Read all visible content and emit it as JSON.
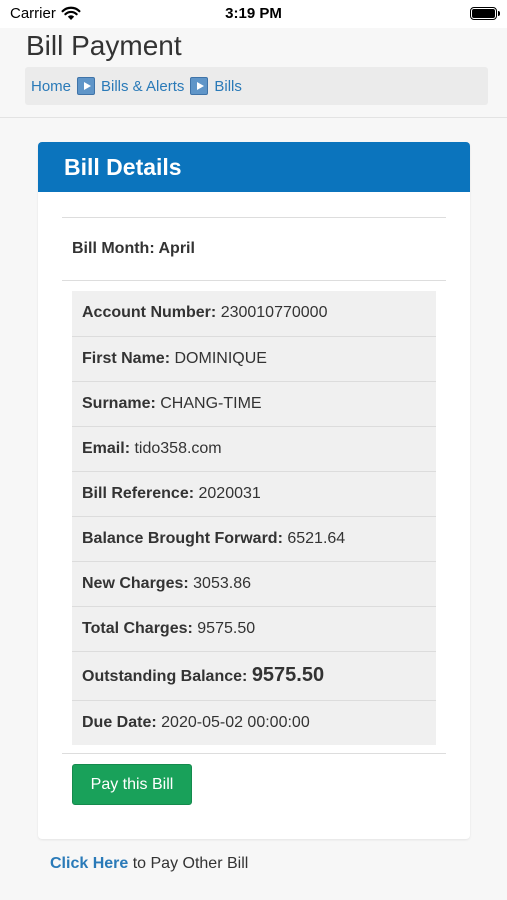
{
  "status_bar": {
    "carrier": "Carrier",
    "time": "3:19 PM"
  },
  "header": {
    "title": "Bill Payment",
    "breadcrumb": [
      "Home",
      "Bills & Alerts",
      "Bills"
    ]
  },
  "panel": {
    "heading": "Bill Details",
    "bill_month": "Bill Month: April",
    "rows": [
      {
        "label": "Account Number:",
        "value": "230010770000"
      },
      {
        "label": "First Name:",
        "value": "DOMINIQUE"
      },
      {
        "label": "Surname:",
        "value": "CHANG-TIME"
      },
      {
        "label": "Email:",
        "value": "tido358.com"
      },
      {
        "label": "Bill Reference:",
        "value": "2020031"
      },
      {
        "label": "Balance Brought Forward:",
        "value": "6521.64"
      },
      {
        "label": "New Charges:",
        "value": "3053.86"
      },
      {
        "label": "Total Charges:",
        "value": "9575.50"
      },
      {
        "label": "Outstanding Balance:",
        "value": "9575.50"
      },
      {
        "label": "Due Date:",
        "value": "2020-05-02 00:00:00"
      }
    ],
    "pay_button": "Pay this Bill"
  },
  "footer": {
    "link": "Click Here",
    "text": " to Pay Other Bill"
  }
}
